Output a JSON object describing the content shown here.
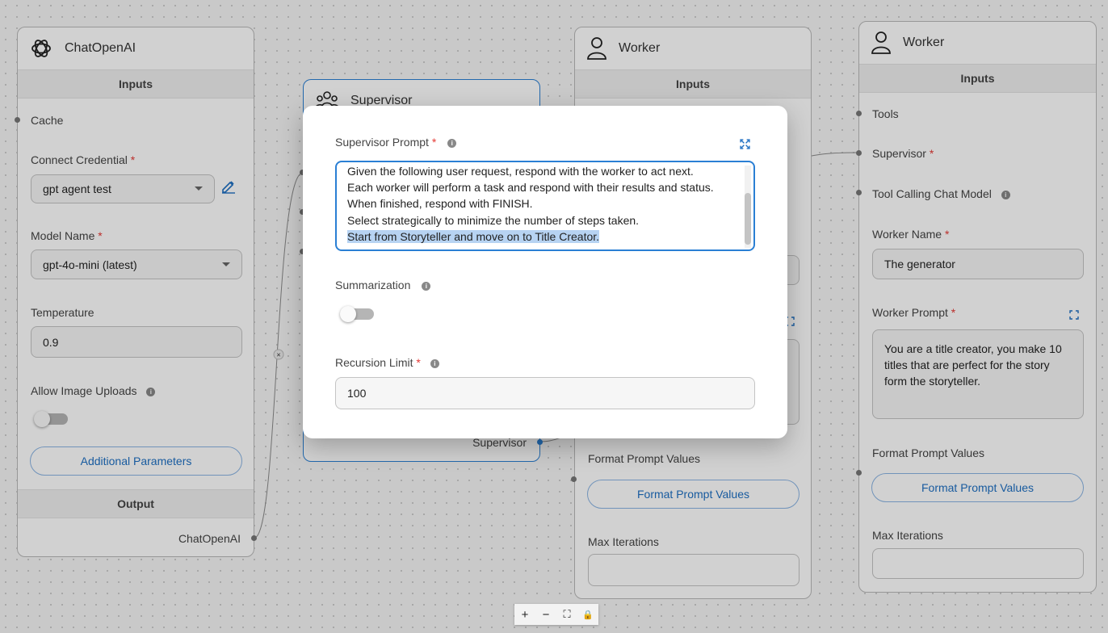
{
  "chat_node": {
    "title": "ChatOpenAI",
    "inputs_label": "Inputs",
    "cache_label": "Cache",
    "credential_label": "Connect Credential",
    "credential_value": "gpt agent test",
    "model_label": "Model Name",
    "model_value": "gpt-4o-mini (latest)",
    "temperature_label": "Temperature",
    "temperature_value": "0.9",
    "image_uploads_label": "Allow Image Uploads",
    "additional_params_label": "Additional Parameters",
    "output_label": "Output",
    "output_value": "ChatOpenAI"
  },
  "supervisor_node": {
    "title": "Supervisor",
    "output_value": "Supervisor"
  },
  "worker_mid": {
    "title": "Worker",
    "inputs_label": "Inputs",
    "format_label": "Format Prompt Values",
    "format_button": "Format Prompt Values",
    "max_iter_label": "Max Iterations"
  },
  "worker_right": {
    "title": "Worker",
    "inputs_label": "Inputs",
    "tools_label": "Tools",
    "supervisor_label": "Supervisor",
    "tool_model_label": "Tool Calling Chat Model",
    "worker_name_label": "Worker Name",
    "worker_name_value": "The generator",
    "worker_prompt_label": "Worker Prompt",
    "worker_prompt_value": "You are a title creator, you make 10 titles that are perfect for the story form the storyteller.",
    "format_label": "Format Prompt Values",
    "format_button": "Format Prompt Values",
    "max_iter_label": "Max Iterations"
  },
  "modal": {
    "supervisor_prompt_label": "Supervisor Prompt",
    "prompt_lines": [
      "Given the following user request, respond with the worker to act next.",
      "Each worker will perform a task and respond with their results and status.",
      "When finished, respond with FINISH.",
      "Select strategically to minimize the number of steps taken.",
      "Start from Storyteller and move on to Title Creator."
    ],
    "summarization_label": "Summarization",
    "recursion_label": "Recursion Limit",
    "recursion_value": "100"
  },
  "controls": {
    "zoom_in": "+",
    "zoom_out": "−",
    "fit": "⛶",
    "lock": "🔒"
  },
  "common": {
    "required_mark": "*",
    "info_glyph": "i"
  }
}
